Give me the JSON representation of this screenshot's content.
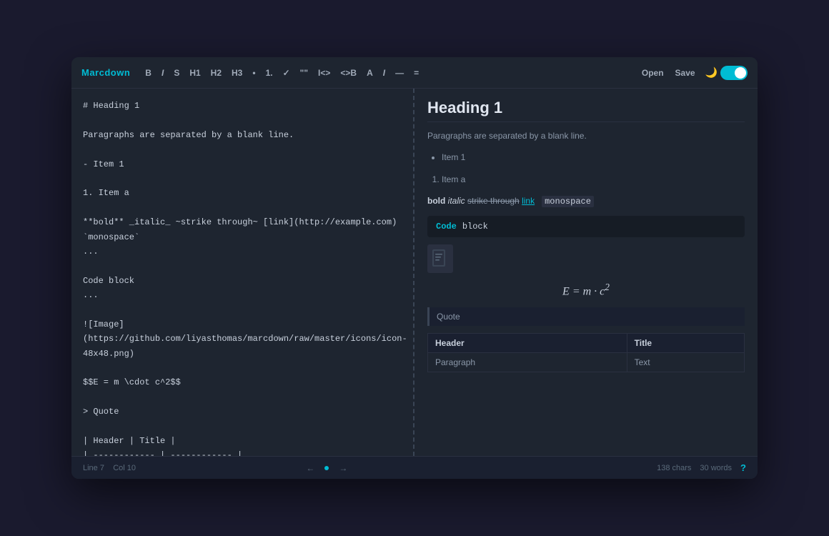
{
  "app": {
    "title": "Marcdown",
    "background": "#1a1a2e"
  },
  "toolbar": {
    "brand": "Marcdown",
    "buttons": [
      {
        "label": "B",
        "name": "bold"
      },
      {
        "label": "I",
        "name": "italic"
      },
      {
        "label": "S",
        "name": "strikethrough"
      },
      {
        "label": "H1",
        "name": "h1"
      },
      {
        "label": "H2",
        "name": "h2"
      },
      {
        "label": "H3",
        "name": "h3"
      },
      {
        "label": "•",
        "name": "bullet"
      },
      {
        "label": "1.",
        "name": "ordered-list"
      },
      {
        "label": "✓",
        "name": "checklist"
      },
      {
        "label": "\"\"",
        "name": "quote"
      },
      {
        "label": "I<>",
        "name": "inline-code"
      },
      {
        "label": "<>B",
        "name": "code-block"
      },
      {
        "label": "A",
        "name": "link"
      },
      {
        "label": "I",
        "name": "image"
      },
      {
        "label": "—",
        "name": "hr"
      },
      {
        "label": "=",
        "name": "math"
      }
    ],
    "open_label": "Open",
    "save_label": "Save",
    "theme_icon": "🌙"
  },
  "editor": {
    "content": "# Heading 1\n\nParagraphs are separated by a blank line.\n\n- Item 1\n\n1. Item a\n\n**bold** _italic_ ~strike through~ [link](http://example.com)\n`monospace`\n...\n\nCode block\n...\n\n![Image]\n(https://github.com/liyasthomas/marcdown/raw/master/icons/icon-\n48x48.png)\n\n$$E = m \\cdot c^2$$\n\n> Quote\n\n| Header | Title |\n| ------------ | ------------ |\n| Paragraph | Text |"
  },
  "preview": {
    "h1": "Heading 1",
    "paragraph": "Paragraphs are separated by a blank line.",
    "bullet_item": "Item 1",
    "ordered_item": "Item a",
    "inline_bold": "bold",
    "inline_italic": "italic",
    "inline_strike": "strike through",
    "inline_link": "link",
    "inline_mono": "monospace",
    "code_keyword": "Code",
    "code_text": "block",
    "math": "E = m · c²",
    "quote": "Quote",
    "table": {
      "headers": [
        "Header",
        "Title"
      ],
      "rows": [
        [
          "Paragraph",
          "Text"
        ]
      ]
    }
  },
  "statusbar": {
    "line": "Line 7",
    "col": "Col 10",
    "chars": "138 chars",
    "words": "30 words",
    "help": "?"
  }
}
